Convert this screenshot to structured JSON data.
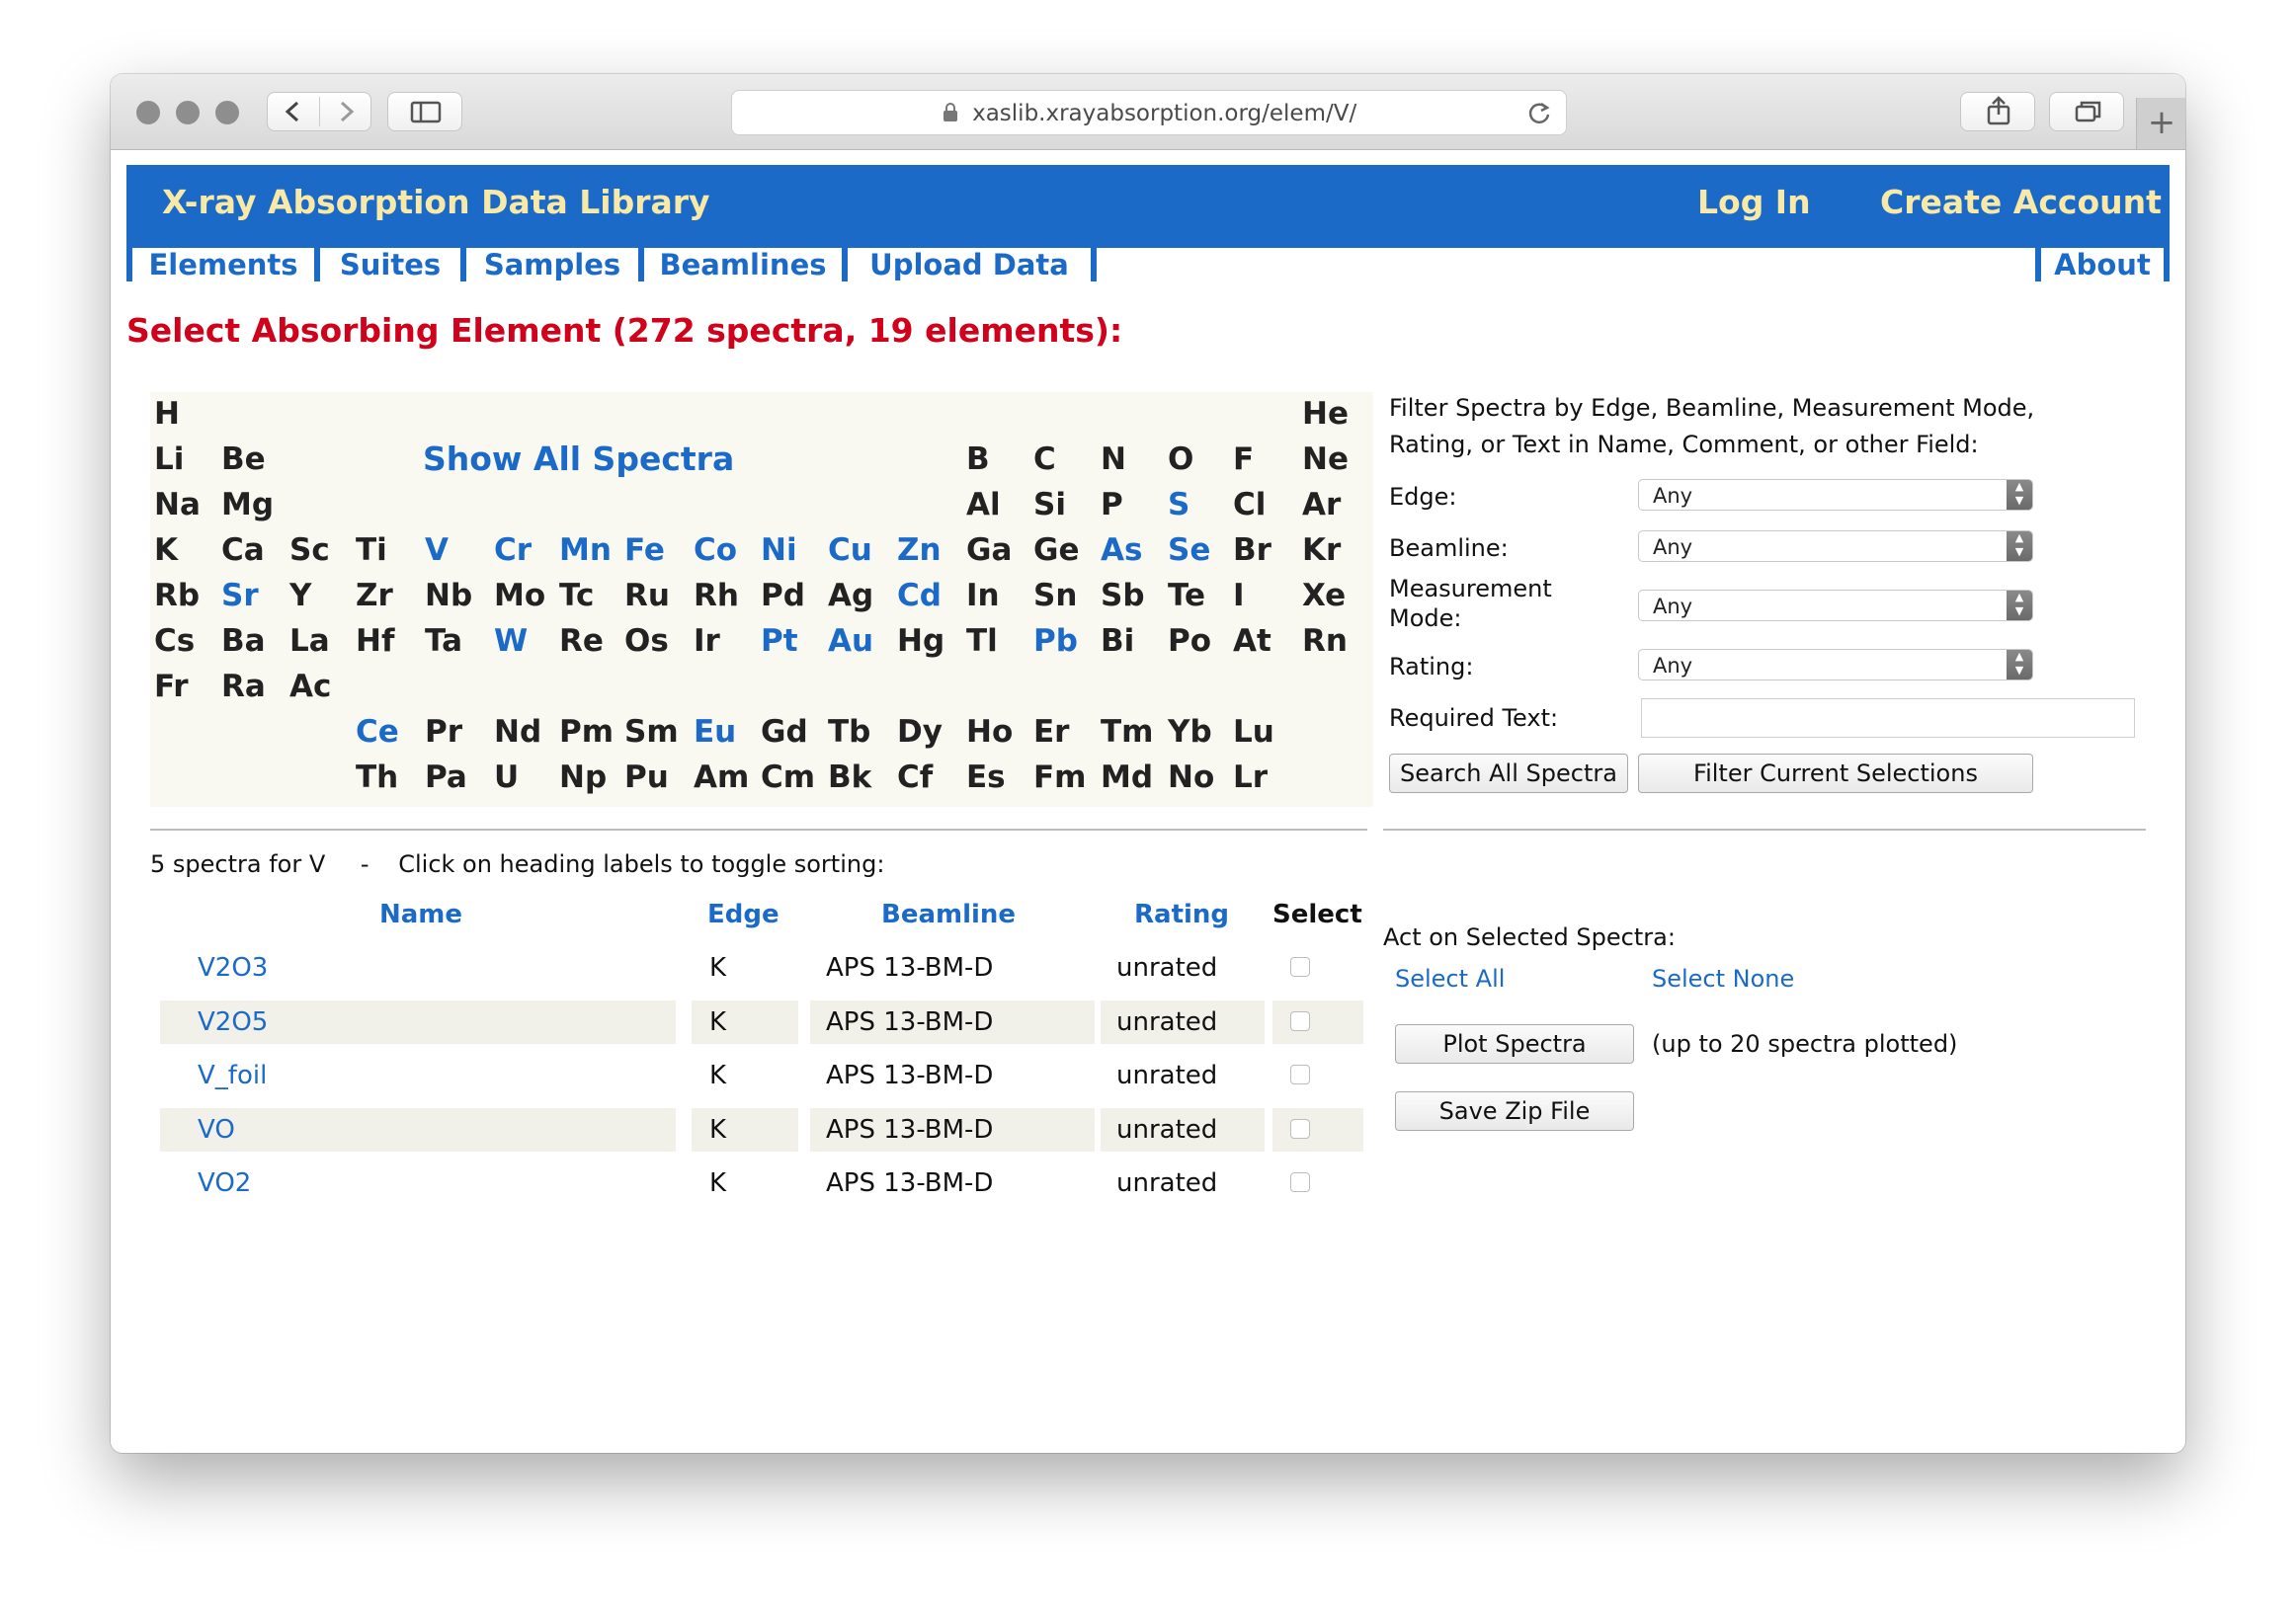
{
  "browser": {
    "url": "xaslib.xrayabsorption.org/elem/V/"
  },
  "site": {
    "title": "X-ray Absorption Data Library",
    "login": "Log In",
    "create_account": "Create Account",
    "nav": [
      "Elements",
      "Suites",
      "Samples",
      "Beamlines",
      "Upload Data"
    ],
    "about": "About"
  },
  "heading": "Select Absorbing Element (272 spectra, 19 elements):",
  "periodic_table": {
    "show_all": "Show All Spectra",
    "rows": [
      [
        [
          "H",
          0,
          0
        ],
        [
          "He",
          0,
          17
        ]
      ],
      [
        [
          "Li",
          0,
          0
        ],
        [
          "Be",
          0,
          1
        ],
        [
          "B",
          0,
          12
        ],
        [
          "C",
          0,
          13
        ],
        [
          "N",
          0,
          14
        ],
        [
          "O",
          0,
          15
        ],
        [
          "F",
          0,
          16
        ],
        [
          "Ne",
          0,
          17
        ]
      ],
      [
        [
          "Na",
          0,
          0
        ],
        [
          "Mg",
          0,
          1
        ],
        [
          "Al",
          0,
          12
        ],
        [
          "Si",
          0,
          13
        ],
        [
          "P",
          0,
          14
        ],
        [
          "S",
          1,
          15
        ],
        [
          "Cl",
          0,
          16
        ],
        [
          "Ar",
          0,
          17
        ]
      ],
      [
        [
          "K",
          0,
          0
        ],
        [
          "Ca",
          0,
          1
        ],
        [
          "Sc",
          0,
          2
        ],
        [
          "Ti",
          0,
          3
        ],
        [
          "V",
          1,
          4
        ],
        [
          "Cr",
          1,
          5
        ],
        [
          "Mn",
          1,
          6
        ],
        [
          "Fe",
          1,
          7
        ],
        [
          "Co",
          1,
          8
        ],
        [
          "Ni",
          1,
          9
        ],
        [
          "Cu",
          1,
          10
        ],
        [
          "Zn",
          1,
          11
        ],
        [
          "Ga",
          0,
          12
        ],
        [
          "Ge",
          0,
          13
        ],
        [
          "As",
          1,
          14
        ],
        [
          "Se",
          1,
          15
        ],
        [
          "Br",
          0,
          16
        ],
        [
          "Kr",
          0,
          17
        ]
      ],
      [
        [
          "Rb",
          0,
          0
        ],
        [
          "Sr",
          1,
          1
        ],
        [
          "Y",
          0,
          2
        ],
        [
          "Zr",
          0,
          3
        ],
        [
          "Nb",
          0,
          4
        ],
        [
          "Mo",
          0,
          5
        ],
        [
          "Tc",
          0,
          6
        ],
        [
          "Ru",
          0,
          7
        ],
        [
          "Rh",
          0,
          8
        ],
        [
          "Pd",
          0,
          9
        ],
        [
          "Ag",
          0,
          10
        ],
        [
          "Cd",
          1,
          11
        ],
        [
          "In",
          0,
          12
        ],
        [
          "Sn",
          0,
          13
        ],
        [
          "Sb",
          0,
          14
        ],
        [
          "Te",
          0,
          15
        ],
        [
          "I",
          0,
          16
        ],
        [
          "Xe",
          0,
          17
        ]
      ],
      [
        [
          "Cs",
          0,
          0
        ],
        [
          "Ba",
          0,
          1
        ],
        [
          "La",
          0,
          2
        ],
        [
          "Hf",
          0,
          3
        ],
        [
          "Ta",
          0,
          4
        ],
        [
          "W",
          1,
          5
        ],
        [
          "Re",
          0,
          6
        ],
        [
          "Os",
          0,
          7
        ],
        [
          "Ir",
          0,
          8
        ],
        [
          "Pt",
          1,
          9
        ],
        [
          "Au",
          1,
          10
        ],
        [
          "Hg",
          0,
          11
        ],
        [
          "Tl",
          0,
          12
        ],
        [
          "Pb",
          1,
          13
        ],
        [
          "Bi",
          0,
          14
        ],
        [
          "Po",
          0,
          15
        ],
        [
          "At",
          0,
          16
        ],
        [
          "Rn",
          0,
          17
        ]
      ],
      [
        [
          "Fr",
          0,
          0
        ],
        [
          "Ra",
          0,
          1
        ],
        [
          "Ac",
          0,
          2
        ]
      ],
      [
        [
          "Ce",
          1,
          3
        ],
        [
          "Pr",
          0,
          4
        ],
        [
          "Nd",
          0,
          5
        ],
        [
          "Pm",
          0,
          6
        ],
        [
          "Sm",
          0,
          7
        ],
        [
          "Eu",
          1,
          8
        ],
        [
          "Gd",
          0,
          9
        ],
        [
          "Tb",
          0,
          10
        ],
        [
          "Dy",
          0,
          11
        ],
        [
          "Ho",
          0,
          12
        ],
        [
          "Er",
          0,
          13
        ],
        [
          "Tm",
          0,
          14
        ],
        [
          "Yb",
          0,
          15
        ],
        [
          "Lu",
          0,
          16
        ]
      ],
      [
        [
          "Th",
          0,
          3
        ],
        [
          "Pa",
          0,
          4
        ],
        [
          "U",
          0,
          5
        ],
        [
          "Np",
          0,
          6
        ],
        [
          "Pu",
          0,
          7
        ],
        [
          "Am",
          0,
          8
        ],
        [
          "Cm",
          0,
          9
        ],
        [
          "Bk",
          0,
          10
        ],
        [
          "Cf",
          0,
          11
        ],
        [
          "Es",
          0,
          12
        ],
        [
          "Fm",
          0,
          13
        ],
        [
          "Md",
          0,
          14
        ],
        [
          "No",
          0,
          15
        ],
        [
          "Lr",
          0,
          16
        ]
      ]
    ]
  },
  "filter": {
    "intro_1": "Filter Spectra by Edge, Beamline, Measurement Mode,",
    "intro_2": "Rating, or Text in Name, Comment, or other Field:",
    "edge_label": "Edge:",
    "edge_value": "Any",
    "beamline_label": "Beamline:",
    "beamline_value": "Any",
    "mode_label_1": "Measurement",
    "mode_label_2": "Mode:",
    "mode_value": "Any",
    "rating_label": "Rating:",
    "rating_value": "Any",
    "required_text_label": "Required Text:",
    "required_text_value": "",
    "search_all": "Search All Spectra",
    "filter_current": "Filter Current Selections"
  },
  "results": {
    "count_text": "5 spectra for V",
    "dash": "-",
    "hint": "Click on heading labels to toggle sorting:",
    "headers": {
      "name": "Name",
      "edge": "Edge",
      "beamline": "Beamline",
      "rating": "Rating",
      "select": "Select"
    },
    "rows": [
      {
        "name": "V2O3",
        "edge": "K",
        "beamline": "APS 13-BM-D",
        "rating": "unrated"
      },
      {
        "name": "V2O5",
        "edge": "K",
        "beamline": "APS 13-BM-D",
        "rating": "unrated"
      },
      {
        "name": "V_foil",
        "edge": "K",
        "beamline": "APS 13-BM-D",
        "rating": "unrated"
      },
      {
        "name": "VO",
        "edge": "K",
        "beamline": "APS 13-BM-D",
        "rating": "unrated"
      },
      {
        "name": "VO2",
        "edge": "K",
        "beamline": "APS 13-BM-D",
        "rating": "unrated"
      }
    ]
  },
  "actions": {
    "title": "Act on Selected Spectra:",
    "select_all": "Select All",
    "select_none": "Select None",
    "plot": "Plot Spectra",
    "plot_note": "(up to 20 spectra plotted)",
    "save_zip": "Save Zip File"
  }
}
